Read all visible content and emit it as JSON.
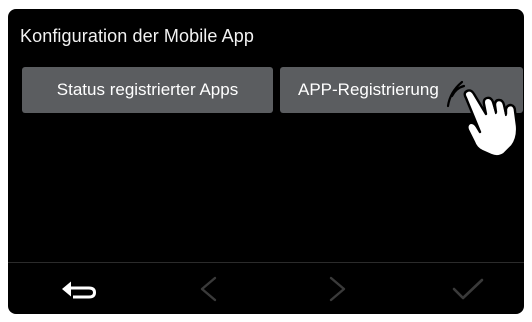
{
  "screen": {
    "title": "Konfiguration der Mobile App"
  },
  "buttons": {
    "status_label": "Status registrierter Apps",
    "registration_label": "APP-Registrierung"
  },
  "nav": {
    "back_icon": "return-arrow-icon",
    "prev_icon": "chevron-left-icon",
    "next_icon": "chevron-right-icon",
    "confirm_icon": "checkmark-icon",
    "back_enabled": true,
    "prev_enabled": false,
    "next_enabled": false,
    "confirm_enabled": false
  },
  "overlay": {
    "pointer_icon": "tapping-hand-icon"
  },
  "colors": {
    "screen_background": "#000000",
    "button_background": "#5b5d60",
    "text": "#ffffff",
    "disabled_icon": "#3a3a3a"
  }
}
